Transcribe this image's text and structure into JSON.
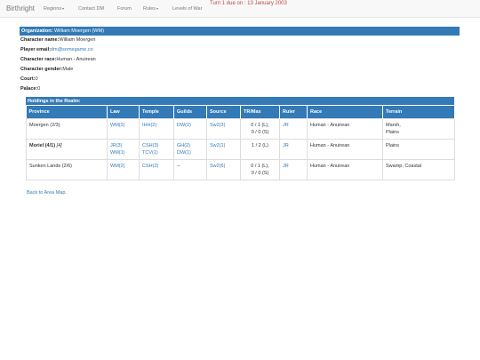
{
  "navbar": {
    "brand": "Birthright",
    "items": [
      {
        "label": "Regions",
        "dropdown": true
      },
      {
        "label": "Contact DM",
        "dropdown": false
      },
      {
        "label": "Forum",
        "dropdown": false
      },
      {
        "label": "Rules",
        "dropdown": true
      },
      {
        "label": "Levels of War",
        "dropdown": false
      }
    ],
    "turn_notice": "Turn 1 due on : 13 January 2003"
  },
  "character": {
    "org_label": "Organization:",
    "org_value": "William Moergen (WM)",
    "name_label": "Character name:",
    "name_value": "William Moergen",
    "email_label": "Player email:",
    "email_value": "dm@somegame.co",
    "race_label": "Character race:",
    "race_value": "Human - Anuirean",
    "gender_label": "Character gender:",
    "gender_value": "Male",
    "court_label": "Court:",
    "court_value": "0",
    "palace_label": "Palace:",
    "palace_value": "0"
  },
  "holdings": {
    "title": "Holdings in the Realm:",
    "columns": [
      "Province",
      "Law",
      "Temple",
      "Guilds",
      "Source",
      "TR/Max",
      "Ruler",
      "Race",
      "Terrain"
    ],
    "rows": [
      {
        "province": "Moergen (2/3)",
        "bold": false,
        "note": "",
        "law": [
          "WM(2)"
        ],
        "temple": [
          "IHH(2)"
        ],
        "guilds": [
          "DW(2)"
        ],
        "source": [
          "Sw2(3)"
        ],
        "trmax": [
          "0 / 1 (L),",
          "0 / 0 (S)"
        ],
        "ruler": "JR",
        "race": "Human - Anuirean",
        "terrain": [
          "Marsh,",
          "Plains"
        ]
      },
      {
        "province": "Moriel (4/1)",
        "bold": true,
        "note": "[4]",
        "law": [
          "JR(3)",
          "WM(1)"
        ],
        "temple": [
          "CSH(3)",
          "TCV(1)"
        ],
        "guilds": [
          "GH(2)",
          "DW(1)"
        ],
        "source": [
          "Sw2(1)"
        ],
        "trmax": [
          "1 / 2 (L)"
        ],
        "ruler": "JR",
        "race": "Human - Anuirean",
        "terrain": [
          "Plains"
        ]
      },
      {
        "province": "Sunken Lands (2/6)",
        "bold": false,
        "note": "",
        "law": [
          "WM(2)"
        ],
        "temple": [
          "CSH(2)"
        ],
        "guilds": [
          "--"
        ],
        "source": [
          "Sw2(6)"
        ],
        "trmax": [
          "0 / 1 (L),",
          "0 / 0 (S)"
        ],
        "ruler": "JR",
        "race": "Human - Anuirean",
        "terrain": [
          "Swamp, Coastal"
        ]
      }
    ]
  },
  "back_link": "Back to Area Map.",
  "colors": {
    "accent": "#337ab7",
    "turn_notice": "#b94a48",
    "navbar_bg": "#f8f8f8"
  }
}
